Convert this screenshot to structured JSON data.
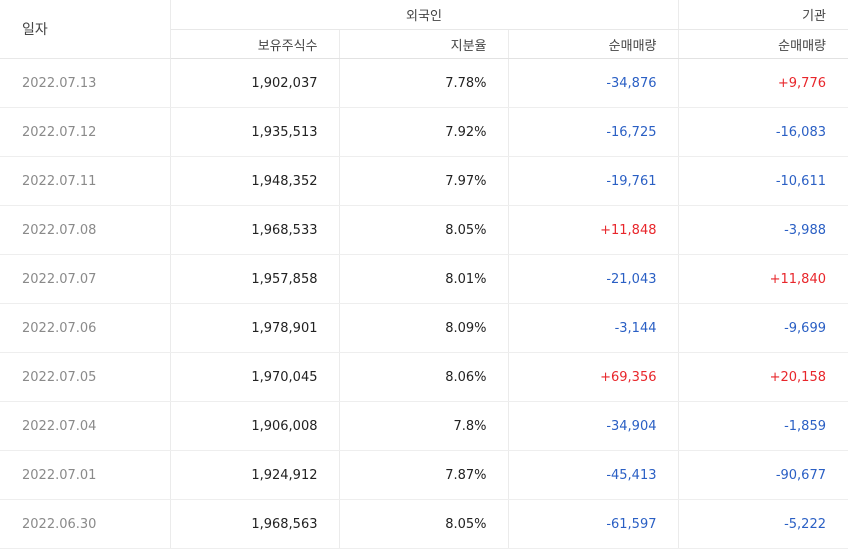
{
  "header": {
    "date_label": "일자",
    "foreign_group_label": "외국인",
    "institution_group_label": "기관",
    "holdings_label": "보유주식수",
    "ratio_label": "지분율",
    "foreign_net_label": "순매매량",
    "institution_net_label": "순매매량"
  },
  "colors": {
    "positive": "#e8262b",
    "negative": "#2a5fc4"
  },
  "rows": [
    {
      "date": "2022.07.13",
      "holdings": "1,902,037",
      "ratio": "7.78%",
      "foreign_net": "-34,876",
      "inst_net": "+9,776"
    },
    {
      "date": "2022.07.12",
      "holdings": "1,935,513",
      "ratio": "7.92%",
      "foreign_net": "-16,725",
      "inst_net": "-16,083"
    },
    {
      "date": "2022.07.11",
      "holdings": "1,948,352",
      "ratio": "7.97%",
      "foreign_net": "-19,761",
      "inst_net": "-10,611"
    },
    {
      "date": "2022.07.08",
      "holdings": "1,968,533",
      "ratio": "8.05%",
      "foreign_net": "+11,848",
      "inst_net": "-3,988"
    },
    {
      "date": "2022.07.07",
      "holdings": "1,957,858",
      "ratio": "8.01%",
      "foreign_net": "-21,043",
      "inst_net": "+11,840"
    },
    {
      "date": "2022.07.06",
      "holdings": "1,978,901",
      "ratio": "8.09%",
      "foreign_net": "-3,144",
      "inst_net": "-9,699"
    },
    {
      "date": "2022.07.05",
      "holdings": "1,970,045",
      "ratio": "8.06%",
      "foreign_net": "+69,356",
      "inst_net": "+20,158"
    },
    {
      "date": "2022.07.04",
      "holdings": "1,906,008",
      "ratio": "7.8%",
      "foreign_net": "-34,904",
      "inst_net": "-1,859"
    },
    {
      "date": "2022.07.01",
      "holdings": "1,924,912",
      "ratio": "7.87%",
      "foreign_net": "-45,413",
      "inst_net": "-90,677"
    },
    {
      "date": "2022.06.30",
      "holdings": "1,968,563",
      "ratio": "8.05%",
      "foreign_net": "-61,597",
      "inst_net": "-5,222"
    }
  ]
}
